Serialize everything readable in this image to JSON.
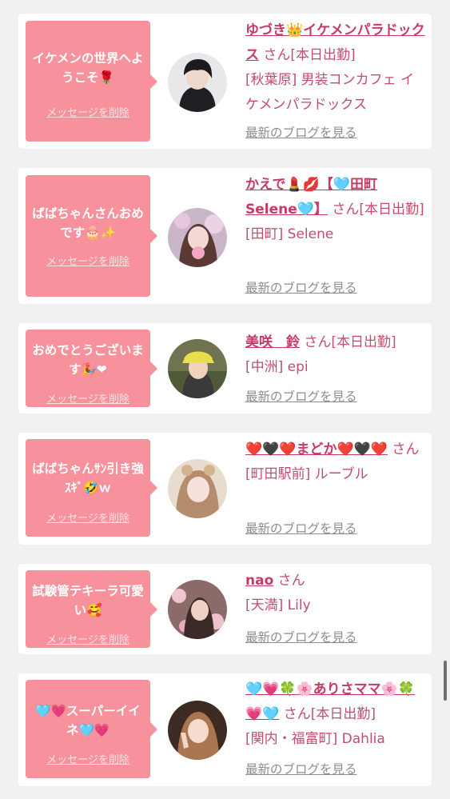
{
  "delete_label": "メッセージを削除",
  "blog_label": "最新のブログを見る",
  "accent_color": "#f7929c",
  "name_color": "#c73a63",
  "entries": [
    {
      "message": "イケメンの世界へようこそ🌹",
      "name": "ゆづき👑イケメンパラドックス",
      "san": " さん[本日出勤]",
      "shop": "[秋葉原] 男装コンカフェ イケメンパラドックス"
    },
    {
      "message": "ばばちゃんさんおめです🎂✨",
      "name": "かえで💄💋【🩵田町Selene🩵】",
      "san": " さん[本日出勤]",
      "shop": "[田町] Selene"
    },
    {
      "message": "おめでとうございます🎉❤",
      "name": "美咲　鈴",
      "san": " さん[本日出勤]",
      "shop": "[中洲] epi"
    },
    {
      "message": "ばばちゃんｻﾝ引き強ｽｷﾞ🤣ｗ",
      "name": "❤️🖤❤️まどか❤️🖤❤️",
      "san": " さん",
      "shop": "[町田駅前] ルーブル"
    },
    {
      "message": "試験管テキーラ可愛い🥰",
      "name": "nao",
      "san": " さん",
      "shop": "[天満] Lily"
    },
    {
      "message": "🩵💗スーパーイイネ🩵💗",
      "name": "🩵💗🍀🌸ありさママ🌸🍀💗🩵",
      "san": " さん[本日出勤]",
      "shop": "[関内・福富町] Dahlia"
    }
  ]
}
